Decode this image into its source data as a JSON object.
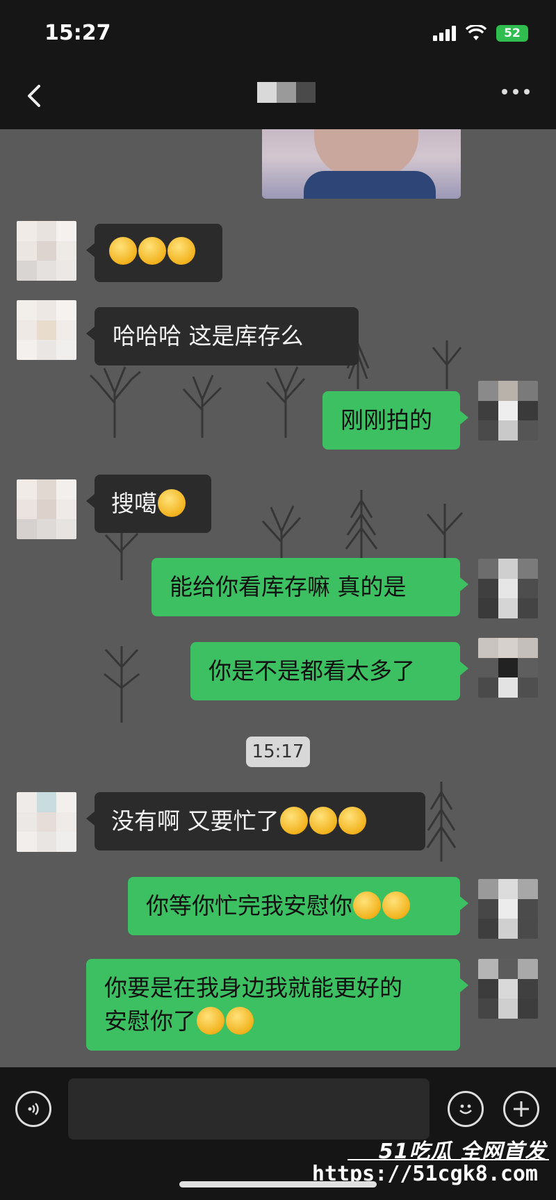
{
  "status_bar": {
    "time": "15:27",
    "battery": "52"
  },
  "header": {
    "back_icon": "chevron-left-icon",
    "more_icon": "more-dots-icon"
  },
  "messages": [
    {
      "id": "m1",
      "side": "in",
      "text": "",
      "emojis": 3
    },
    {
      "id": "m2",
      "side": "in",
      "text": "哈哈哈  这是库存么",
      "emojis": 0
    },
    {
      "id": "m3",
      "side": "out",
      "text": "刚刚拍的",
      "emojis": 0
    },
    {
      "id": "m4",
      "side": "in",
      "text": "搜噶",
      "emojis": 1
    },
    {
      "id": "m5",
      "side": "out",
      "text": "能给你看库存嘛 真的是",
      "emojis": 0
    },
    {
      "id": "m6",
      "side": "out",
      "text": "你是不是都看太多了",
      "emojis": 0
    },
    {
      "id": "m7",
      "side": "in",
      "text": "没有啊  又要忙了",
      "emojis": 3
    },
    {
      "id": "m8",
      "side": "out",
      "text": "你等你忙完我安慰你",
      "emojis": 2
    },
    {
      "id": "m9",
      "side": "out",
      "line1": "你要是在我身边我就能更好的",
      "line2": "安慰你了",
      "emojis": 2
    }
  ],
  "timestamp": "15:17",
  "input_bar": {
    "voice_icon": "voice-icon",
    "emoji_icon": "emoji-icon",
    "plus_icon": "plus-icon"
  },
  "watermark": {
    "brand": "51吃瓜 全网首发",
    "url": "https://51cgk8.com"
  }
}
